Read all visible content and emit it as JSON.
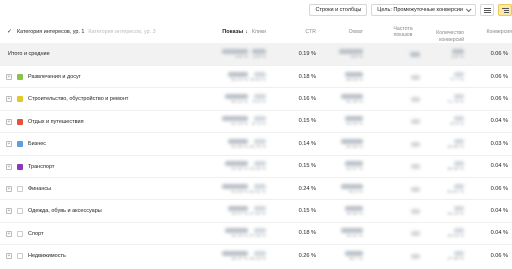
{
  "toolbar": {
    "rows_cols_label": "Строки и столбцы",
    "goals_label": "Цель: Промежуточные конверсии"
  },
  "header": {
    "group_label": "Категория интересов, ур. 1",
    "group_label_faded": "Категория интересов, ур. 3",
    "columns": {
      "shows": "Показы",
      "clicks": "Клики",
      "ctr": "CTR",
      "reach": "Охват",
      "freq_line1": "Частота",
      "freq_line2": "показов",
      "convcount_line1": "Количество",
      "convcount_line2": "конверсий",
      "conv": "Конверсия"
    }
  },
  "total_row": {
    "label": "Итого и средние",
    "shows_sub": "100 %",
    "clicks_sub": "100 %",
    "ctr": "0.19 %",
    "reach_sub": "100 %",
    "convcount_sub": "100 %",
    "conv": "0.06 %"
  },
  "rows": [
    {
      "name": "Развлечения и досуг",
      "color": "#8bc34a",
      "ctr": "0.18 %",
      "conv": "0.06 %",
      "shows_sub": "80.24 %",
      "clicks_sub": "78.83 %",
      "reach_sub": "89.09 %",
      "convcount_sub": "77.7 %"
    },
    {
      "name": "Строительство, обустройство и ремонт",
      "color": "#e6c72a",
      "ctr": "0.16 %",
      "conv": "0.06 %",
      "shows_sub": "80.22 %",
      "clicks_sub": "70.8 %",
      "reach_sub": "81.38 %",
      "convcount_sub": "71.78 %"
    },
    {
      "name": "Отдых и путешествия",
      "color": "#e5533d",
      "ctr": "0.15 %",
      "conv": "0.04 %",
      "shows_sub": "81.18 %",
      "clicks_sub": "67.9 %",
      "reach_sub": "64.25 %",
      "convcount_sub": "43.9 %"
    },
    {
      "name": "Бизнес",
      "color": "#5b9fe0",
      "ctr": "0.14 %",
      "conv": "0.03 %",
      "shows_sub": "54.38 %",
      "clicks_sub": "40.75 %",
      "reach_sub": "50.58 %",
      "convcount_sub": "30.86 %"
    },
    {
      "name": "Транспорт",
      "color": "#8e35c0",
      "ctr": "0.15 %",
      "conv": "0.04 %",
      "shows_sub": "54.35 %",
      "clicks_sub": "43.25 %",
      "reach_sub": "52.67 %",
      "convcount_sub": "36.88 %"
    },
    {
      "name": "Финансы",
      "color": "#ffffff",
      "ctr": "0.24 %",
      "conv": "0.06 %",
      "shows_sub": "53.09 %",
      "clicks_sub": "64.01 %",
      "reach_sub": "50.3 %",
      "convcount_sub": "53.81 %"
    },
    {
      "name": "Одежда, обувь и аксессуары",
      "color": "#ffffff",
      "ctr": "0.15 %",
      "conv": "0.04 %",
      "shows_sub": "46.57 %",
      "clicks_sub": "37.94 %",
      "reach_sub": "45.86 %",
      "convcount_sub": "34.18 %"
    },
    {
      "name": "Спорт",
      "color": "#ffffff",
      "ctr": "0.18 %",
      "conv": "0.04 %",
      "shows_sub": "35.28 %",
      "clicks_sub": "37.08 %",
      "reach_sub": "42.51 %",
      "convcount_sub": "28.02 %"
    },
    {
      "name": "Недвижимость",
      "color": "#ffffff",
      "ctr": "0.26 %",
      "conv": "0.06 %",
      "shows_sub": "35.37 %",
      "clicks_sub": "49.18 %",
      "reach_sub": "38.7 %",
      "convcount_sub": "37.98 %"
    }
  ]
}
